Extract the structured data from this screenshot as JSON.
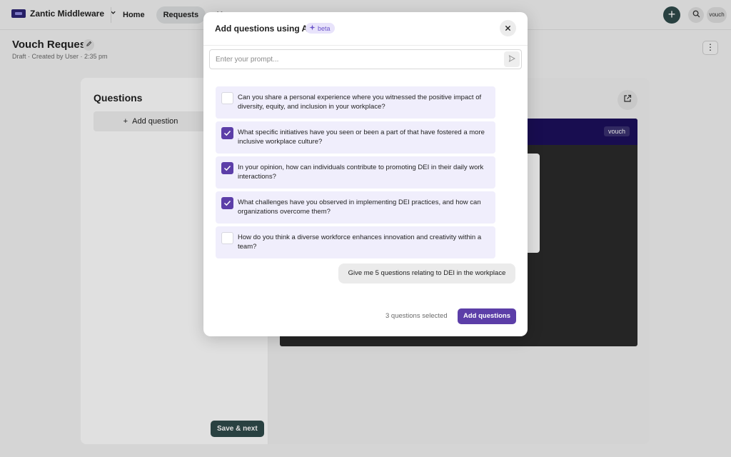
{
  "topbar": {
    "workspace": "Zantic Middleware",
    "nav": [
      {
        "label": "Home",
        "active": false
      },
      {
        "label": "Requests",
        "active": true
      },
      {
        "label": "V",
        "active": false
      }
    ],
    "avatar_text": "vouch"
  },
  "page": {
    "title": "Vouch Request",
    "subtitle": "Draft · Created by User · 2:35 pm"
  },
  "panel": {
    "questions_heading": "Questions",
    "add_question_label": "Add question",
    "save_next_label": "Save & next",
    "preview_chip": "vouch"
  },
  "modal": {
    "title": "Add questions using AI",
    "badge": "beta",
    "prompt_placeholder": "Enter your prompt...",
    "questions": [
      {
        "text": "Can you share a personal experience where you witnessed the positive impact of diversity, equity, and inclusion in your workplace?",
        "checked": false
      },
      {
        "text": "What specific initiatives have you seen or been a part of that have fostered a more inclusive workplace culture?",
        "checked": true
      },
      {
        "text": "In your opinion, how can individuals contribute to promoting DEI in their daily work interactions?",
        "checked": true
      },
      {
        "text": "What challenges have you observed in implementing DEI practices, and how can organizations overcome them?",
        "checked": true
      },
      {
        "text": "How do you think a diverse workforce enhances innovation and creativity within a team?",
        "checked": false
      }
    ],
    "user_prompt": "Give me 5 questions relating to DEI in the workplace",
    "selected_count_text": "3 questions selected",
    "add_button_label": "Add questions"
  },
  "colors": {
    "accent": "#5c3ea8",
    "dark_teal": "#2f4a4a",
    "question_bg": "#f0eefc"
  }
}
